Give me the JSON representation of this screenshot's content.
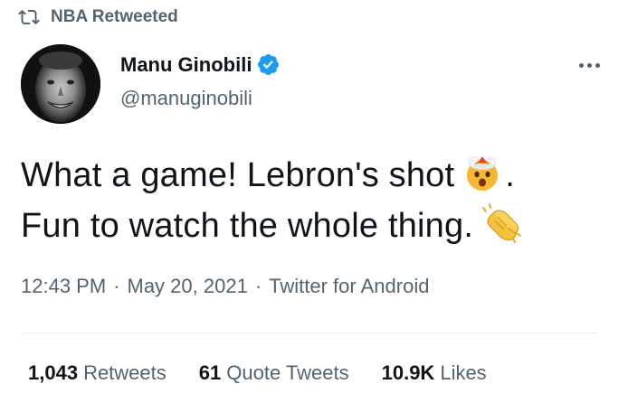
{
  "context": {
    "label": "NBA Retweeted",
    "icon": "retweet-icon"
  },
  "author": {
    "name": "Manu Ginobili",
    "handle": "@manuginobili",
    "verified": true,
    "verified_icon": "verified-badge-icon",
    "avatar": "profile-photo"
  },
  "tweet": {
    "line1": "What a game! Lebron's shot",
    "line1_emoji": "exploding-head-emoji",
    "line1_end": ".",
    "line2": "Fun to watch the whole thing.",
    "line2_emoji": "clapping-hands-emoji"
  },
  "meta": {
    "time": "12:43 PM",
    "separator": "·",
    "date": "May 20, 2021",
    "source": "Twitter for Android"
  },
  "stats": {
    "retweets": {
      "count": "1,043",
      "label": "Retweets"
    },
    "quotes": {
      "count": "61",
      "label": "Quote Tweets"
    },
    "likes": {
      "count": "10.9K",
      "label": "Likes"
    }
  },
  "colors": {
    "text_primary": "#0f1419",
    "text_secondary": "#536471",
    "verified_blue": "#1d9bf0",
    "divider": "#e6ecf0"
  }
}
